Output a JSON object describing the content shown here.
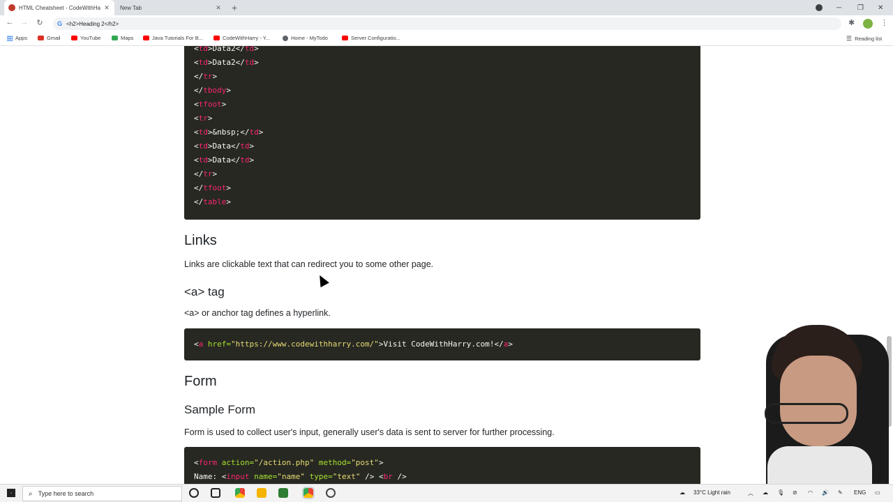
{
  "tabs": [
    {
      "title": "HTML Cheatsheet - CodeWithHa",
      "active": true
    },
    {
      "title": "New Tab",
      "active": false
    }
  ],
  "toolbar": {
    "url": "<h2>Heading 2</h2>"
  },
  "bookmarks": [
    {
      "label": "Apps",
      "icon": "apps-grid-icon"
    },
    {
      "label": "Gmail",
      "icon": "gmail-icon",
      "color": "#d93025"
    },
    {
      "label": "YouTube",
      "icon": "youtube-icon",
      "color": "#ff0000"
    },
    {
      "label": "Maps",
      "icon": "maps-icon",
      "color": "#34a853"
    },
    {
      "label": "Java Tutorials For B...",
      "icon": "youtube-icon",
      "color": "#ff0000"
    },
    {
      "label": "CodeWithHarry - Y...",
      "icon": "youtube-icon",
      "color": "#ff0000"
    },
    {
      "label": "Home - MyTodo",
      "icon": "globe-icon",
      "color": "#5f6368"
    },
    {
      "label": "Server Configuratio...",
      "icon": "youtube-icon",
      "color": "#ff0000"
    }
  ],
  "reading_list": "Reading list",
  "content": {
    "links_heading": "Links",
    "links_text": "Links are clickable text that can redirect you to some other page.",
    "a_tag_heading": "<a> tag",
    "a_tag_text": "<a> or anchor tag defines a hyperlink.",
    "a_code": {
      "open": "<",
      "tag": "a",
      "attr": " href=",
      "val": "\"https://www.codewithharry.com/\"",
      "text": ">Visit CodeWithHarry.com!</",
      "close_tag": "a",
      "end": ">"
    },
    "form_heading": "Form",
    "sample_form_heading": "Sample Form",
    "form_text": "Form is used to collect user's input, generally user's data is sent to server for further processing."
  },
  "table_code_lines": [
    {
      "pre": "<",
      "tag": "td",
      "mid": ">Data2</",
      "tag2": "td",
      "post": ">"
    },
    {
      "pre": "<",
      "tag": "td",
      "mid": ">Data2</",
      "tag2": "td",
      "post": ">"
    },
    {
      "pre": "</",
      "tag": "tr",
      "mid": ">",
      "tag2": "",
      "post": ""
    },
    {
      "pre": "</",
      "tag": "tbody",
      "mid": ">",
      "tag2": "",
      "post": ""
    },
    {
      "pre": "<",
      "tag": "tfoot",
      "mid": ">",
      "tag2": "",
      "post": ""
    },
    {
      "pre": "<",
      "tag": "tr",
      "mid": ">",
      "tag2": "",
      "post": ""
    },
    {
      "pre": "<",
      "tag": "td",
      "mid": ">&nbsp;</",
      "tag2": "td",
      "post": ">"
    },
    {
      "pre": "<",
      "tag": "td",
      "mid": ">Data</",
      "tag2": "td",
      "post": ">"
    },
    {
      "pre": "<",
      "tag": "td",
      "mid": ">Data</",
      "tag2": "td",
      "post": ">"
    },
    {
      "pre": "</",
      "tag": "tr",
      "mid": ">",
      "tag2": "",
      "post": ""
    },
    {
      "pre": "</",
      "tag": "tfoot",
      "mid": ">",
      "tag2": "",
      "post": ""
    },
    {
      "pre": "</",
      "tag": "table",
      "mid": ">",
      "tag2": "",
      "post": ""
    }
  ],
  "form_code": {
    "line1": {
      "open": "<",
      "tag": "form",
      "a1": " action=",
      "v1": "\"/action.php\"",
      "a2": " method=",
      "v2": "\"post\"",
      "end": ">"
    },
    "line2": {
      "label": "Name: ",
      "open": "<",
      "tag": "input",
      "a1": " name=",
      "v1": "\"name\"",
      "a2": " type=",
      "v2": "\"text\"",
      "mid": " /> <",
      "tag2": "br",
      "end": " />"
    }
  },
  "taskbar": {
    "search_placeholder": "Type here to search",
    "weather": "33°C  Light rain",
    "language": "ENG"
  }
}
